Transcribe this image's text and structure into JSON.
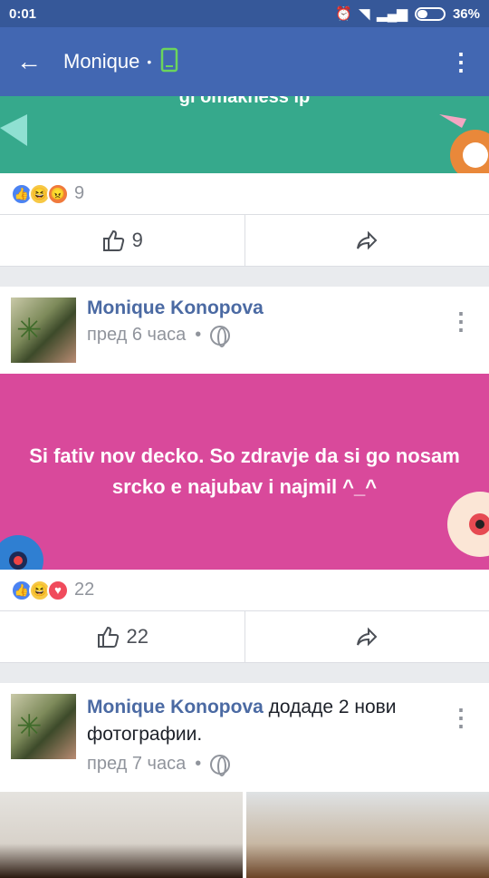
{
  "status_bar": {
    "time": "0:01",
    "battery": "36%"
  },
  "app_bar": {
    "title": "Monique",
    "separator": "•"
  },
  "posts": [
    {
      "banner_text": "ĝi omakness ip",
      "reactions_count": "9",
      "like_count": "9"
    },
    {
      "author": "Monique Konopova",
      "time": "пред 6 часа",
      "dot": "•",
      "text": "Si fativ nov decko. So zdravje da si go nosam srcko e najubav i najmil ^_^",
      "reactions_count": "22",
      "like_count": "22"
    },
    {
      "author": "Monique Konopova",
      "action": "додаде 2 нови фотографии.",
      "time": "пред 7 часа",
      "dot": "•"
    }
  ],
  "colors": {
    "header": "#4267b2",
    "status": "#365899",
    "pink_banner": "#d9499b",
    "green_banner": "#36a98c"
  }
}
